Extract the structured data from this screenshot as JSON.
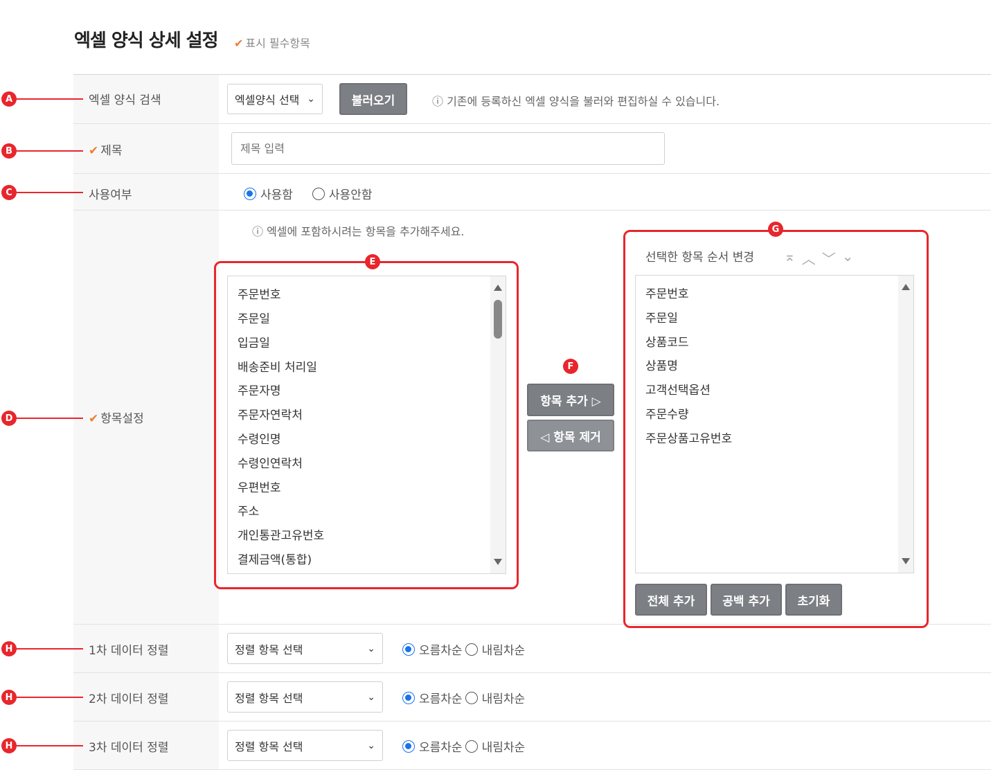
{
  "header": {
    "title": "엑셀 양식 상세 설정",
    "required_note": "표시 필수항목",
    "check_mark": "✔"
  },
  "markers": {
    "a": "A",
    "b": "B",
    "c": "C",
    "d": "D",
    "e": "E",
    "f": "F",
    "g": "G",
    "h": "H"
  },
  "search_row": {
    "label": "엑셀 양식 검색",
    "select_value": "엑셀양식 선택",
    "load_button": "불러오기",
    "info": "ⓘ 기존에 등록하신 엑셀 양식을 불러와 편집하실 수 있습니다."
  },
  "title_row": {
    "label": "제목",
    "placeholder": "제목 입력"
  },
  "use_row": {
    "label": "사용여부",
    "options": [
      "사용함",
      "사용안함"
    ],
    "selected": "사용함"
  },
  "items_row": {
    "label": "항목설정",
    "info": "ⓘ 엑셀에 포함하시려는 항목을 추가해주세요.",
    "available_items": [
      "주문번호",
      "주문일",
      "입금일",
      "배송준비 처리일",
      "주문자명",
      "주문자연락처",
      "수령인명",
      "수령인연락처",
      "우편번호",
      "주소",
      "개인통관고유번호",
      "결제금액(통합)"
    ],
    "add_button": "항목 추가 ▷",
    "remove_button": "◁ 항목 제거",
    "order_title": "선택한 항목 순서 변경",
    "selected_items": [
      "주문번호",
      "주문일",
      "상품코드",
      "상품명",
      "고객선택옵션",
      "주문수량",
      "주문상품고유번호"
    ],
    "add_all_button": "전체 추가",
    "add_blank_button": "공백 추가",
    "reset_button": "초기화"
  },
  "sort_rows": [
    {
      "label": "1차 데이터 정렬",
      "select_value": "정렬 항목 선택",
      "asc": "오름차순",
      "desc": "내림차순"
    },
    {
      "label": "2차 데이터 정렬",
      "select_value": "정렬 항목 선택",
      "asc": "오름차순",
      "desc": "내림차순"
    },
    {
      "label": "3차 데이터 정렬",
      "select_value": "정렬 항목 선택",
      "asc": "오름차순",
      "desc": "내림차순"
    }
  ],
  "colors": {
    "accent_red": "#e8262c",
    "check_orange": "#f07b2d",
    "button_gray": "#7c7f84",
    "radio_blue": "#1a73e8"
  }
}
